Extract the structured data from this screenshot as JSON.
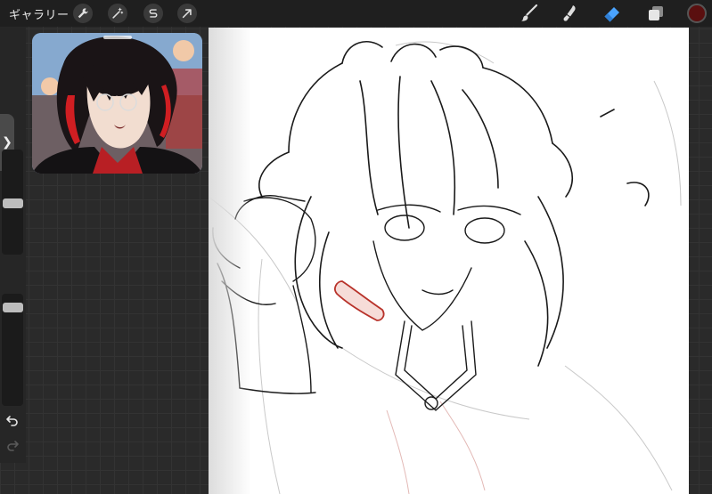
{
  "toolbar": {
    "gallery_label": "ギャラリー",
    "actions_icon": "wrench-icon",
    "adjustments_icon": "magic-wand-icon",
    "selection_icon": "selection-s-icon",
    "transform_icon": "arrow-cursor-icon",
    "brush_icon": "brush-icon",
    "smudge_icon": "smudge-icon",
    "eraser_icon": "eraser-icon",
    "eraser_color": "#4aa3ff",
    "layers_icon": "layers-icon",
    "current_color": "#5a0f0f"
  },
  "sidebar": {
    "size_slider_level": 0.5,
    "opacity_slider_level": 0.9,
    "modifier_icon": "square-icon",
    "undo_icon": "undo-icon",
    "redo_icon": "redo-icon"
  },
  "reference": {
    "description_icon": "reference-image",
    "colors": {
      "hair": "#1a1416",
      "accent": "#d01e22",
      "skin": "#f2ddd0"
    }
  },
  "canvas": {
    "background": "#ffffff",
    "line_color": "#1a1a1a",
    "sketch_color": "#c9c9c9",
    "highlight_color": "#b8322a"
  }
}
